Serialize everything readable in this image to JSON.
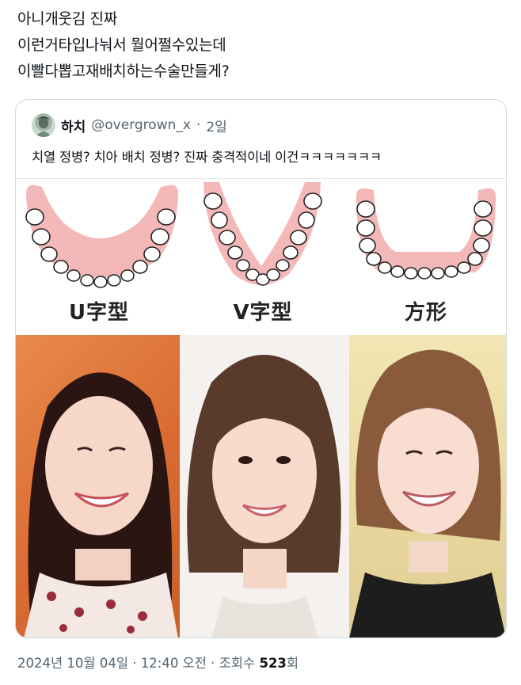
{
  "tweet": {
    "lines": [
      "아니개웃김 진짜",
      "이런거타입나눠서 뭘어쩔수있는데",
      "이빨다뽑고재배치하는수술만들게?"
    ]
  },
  "quote": {
    "avatar_icon": "profile-avatar",
    "name": "하치",
    "handle": "@overgrown_x",
    "separator": "·",
    "time": "2일",
    "text": "치열 정병? 치아 배치 정병? 진짜 충격적이네 이건ㅋㅋㅋㅋㅋㅋㅋ",
    "figure": {
      "arch_types": [
        {
          "label": "U字型"
        },
        {
          "label": "V字型"
        },
        {
          "label": "方形"
        }
      ],
      "photos": [
        "smiling-woman-photo-1",
        "smiling-woman-photo-2",
        "smiling-woman-photo-3"
      ]
    }
  },
  "footer": {
    "date": "2024년 10월 04일",
    "sep1": "·",
    "time": "12:40 오전",
    "sep2": "·",
    "views_label": "조회수",
    "views_count": "523",
    "views_suffix": "회"
  },
  "colors": {
    "gum": "#f4b8b8",
    "text": "#0f1419",
    "muted": "#536471",
    "border": "#cfd9de"
  }
}
